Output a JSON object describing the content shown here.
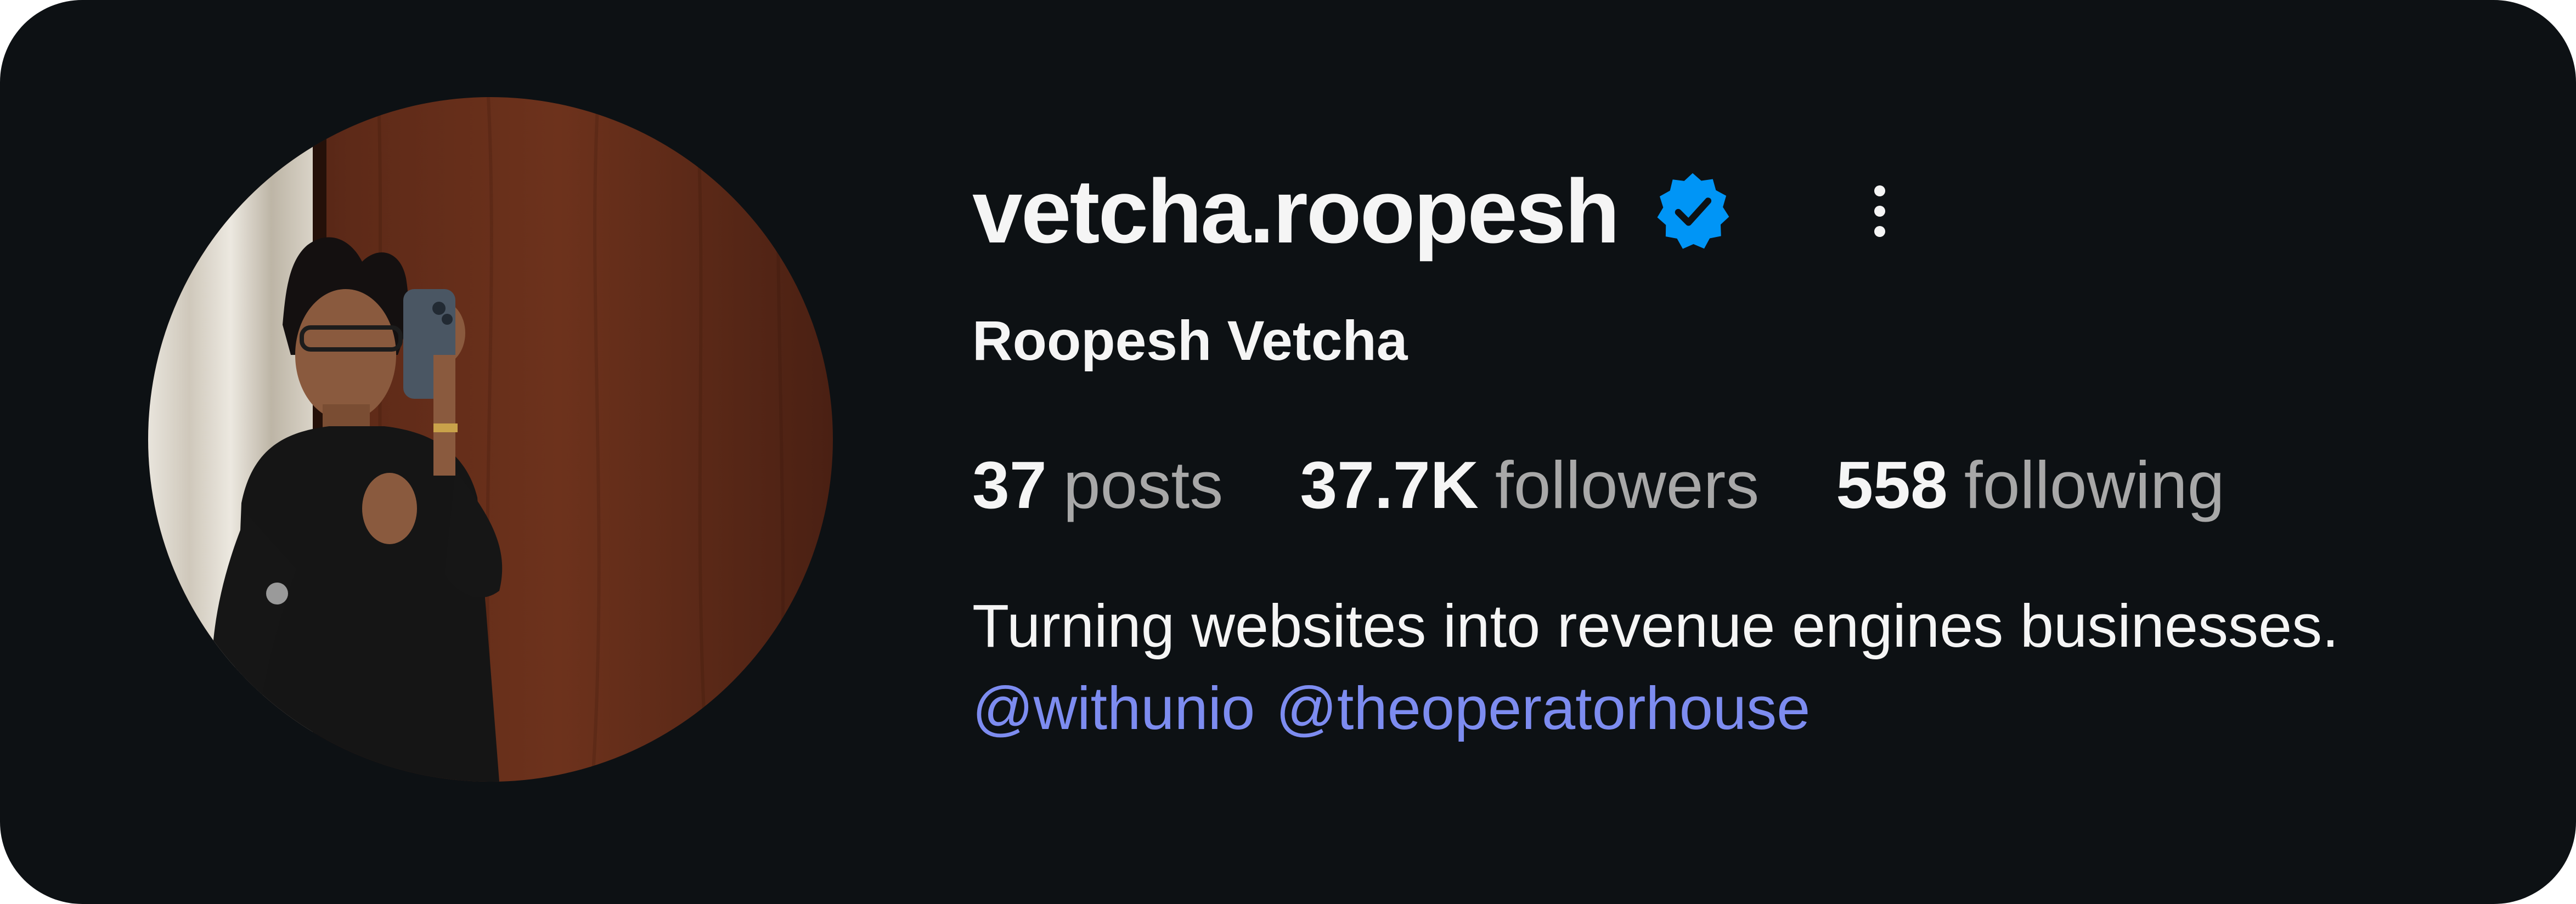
{
  "profile": {
    "username": "vetcha.roopesh",
    "full_name": "Roopesh Vetcha",
    "verified": true,
    "avatar_icon": "profile-photo",
    "more_icon": "vertical-ellipsis-icon"
  },
  "stats": {
    "posts": {
      "value": "37",
      "label": "posts"
    },
    "followers": {
      "value": "37.7K",
      "label": "followers"
    },
    "following": {
      "value": "558",
      "label": "following"
    }
  },
  "bio": {
    "text": "Turning websites into revenue engines businesses.",
    "mentions": [
      "@withunio",
      "@theoperatorhouse"
    ]
  },
  "colors": {
    "background": "#0d1114",
    "primary_text": "#f5f5f5",
    "secondary_text": "#a8a8a8",
    "link": "#7d8cf0",
    "verified_badge": "#0095f6"
  }
}
